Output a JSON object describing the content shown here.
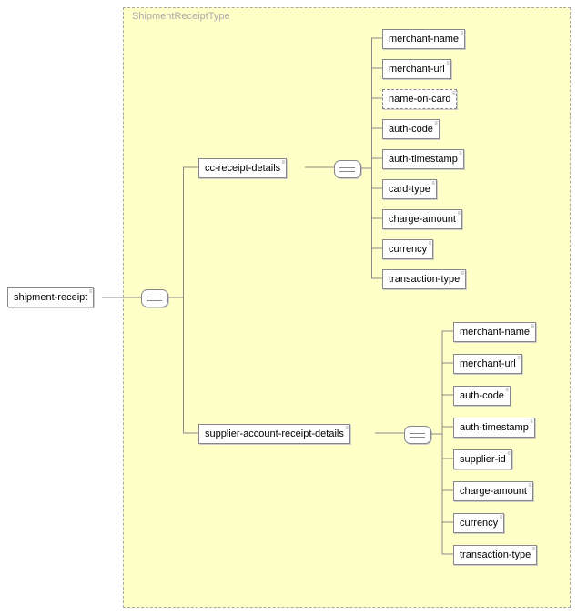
{
  "type_name": "ShipmentReceiptType",
  "root": "shipment-receipt",
  "branch1": {
    "label": "cc-receipt-details",
    "children": [
      "merchant-name",
      "merchant-url",
      "name-on-card",
      "auth-code",
      "auth-timestamp",
      "card-type",
      "charge-amount",
      "currency",
      "transaction-type"
    ],
    "optional_index": 2
  },
  "branch2": {
    "label": "supplier-account-receipt-details",
    "children": [
      "merchant-name",
      "merchant-url",
      "auth-code",
      "auth-timestamp",
      "supplier-id",
      "charge-amount",
      "currency",
      "transaction-type"
    ]
  }
}
